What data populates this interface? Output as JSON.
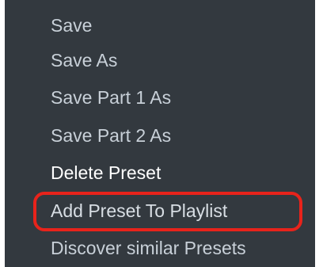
{
  "menu": {
    "items": [
      {
        "label": "Save"
      },
      {
        "label": "Save As"
      },
      {
        "label": "Save Part 1 As"
      },
      {
        "label": "Save Part 2 As"
      },
      {
        "label": "Delete Preset"
      },
      {
        "label": "Add Preset To Playlist"
      },
      {
        "label": "Discover similar Presets"
      }
    ],
    "highlight_color": "#e8231b",
    "background_color": "#33393f"
  }
}
